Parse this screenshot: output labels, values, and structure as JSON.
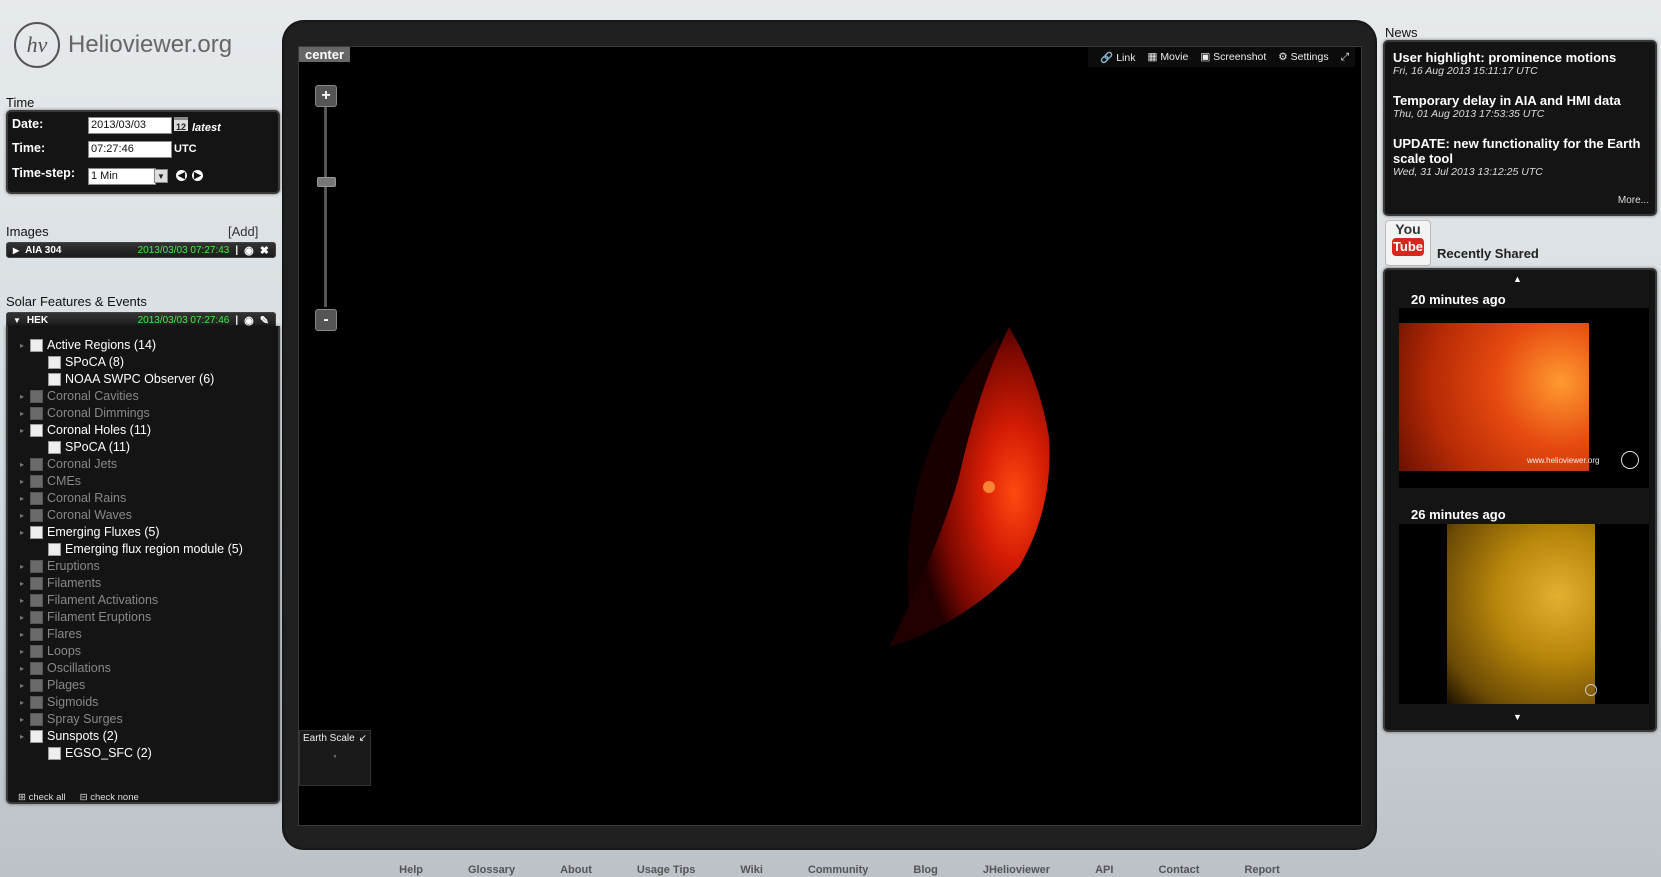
{
  "brand": {
    "logo_mark": "hv",
    "name": "Helioviewer.org"
  },
  "time": {
    "section_title": "Time",
    "date_label": "Date:",
    "date_value": "2013/03/03",
    "calendar_icon": "12",
    "latest_label": "latest",
    "time_label": "Time:",
    "time_value": "07:27:46",
    "utc_label": "UTC",
    "timestep_label": "Time-step:",
    "timestep_value": "1 Min"
  },
  "images": {
    "section_title": "Images",
    "add_label": "[Add]",
    "layer": {
      "name": "AIA 304",
      "timestamp": "2013/03/03 07:27:43",
      "sep": "|"
    }
  },
  "events": {
    "section_title": "Solar Features & Events",
    "header": {
      "name": "HEK",
      "timestamp": "2013/03/03 07:27:46",
      "sep": "|"
    },
    "items": [
      {
        "label": "Active Regions (14)",
        "level": 0,
        "enabled": true
      },
      {
        "label": "SPoCA (8)",
        "level": 1,
        "enabled": true
      },
      {
        "label": "NOAA SWPC Observer (6)",
        "level": 1,
        "enabled": true
      },
      {
        "label": "Coronal Cavities",
        "level": 0,
        "enabled": false
      },
      {
        "label": "Coronal Dimmings",
        "level": 0,
        "enabled": false
      },
      {
        "label": "Coronal Holes (11)",
        "level": 0,
        "enabled": true
      },
      {
        "label": "SPoCA (11)",
        "level": 1,
        "enabled": true
      },
      {
        "label": "Coronal Jets",
        "level": 0,
        "enabled": false
      },
      {
        "label": "CMEs",
        "level": 0,
        "enabled": false
      },
      {
        "label": "Coronal Rains",
        "level": 0,
        "enabled": false
      },
      {
        "label": "Coronal Waves",
        "level": 0,
        "enabled": false
      },
      {
        "label": "Emerging Fluxes (5)",
        "level": 0,
        "enabled": true
      },
      {
        "label": "Emerging flux region module (5)",
        "level": 1,
        "enabled": true
      },
      {
        "label": "Eruptions",
        "level": 0,
        "enabled": false
      },
      {
        "label": "Filaments",
        "level": 0,
        "enabled": false
      },
      {
        "label": "Filament Activations",
        "level": 0,
        "enabled": false
      },
      {
        "label": "Filament Eruptions",
        "level": 0,
        "enabled": false
      },
      {
        "label": "Flares",
        "level": 0,
        "enabled": false
      },
      {
        "label": "Loops",
        "level": 0,
        "enabled": false
      },
      {
        "label": "Oscillations",
        "level": 0,
        "enabled": false
      },
      {
        "label": "Plages",
        "level": 0,
        "enabled": false
      },
      {
        "label": "Sigmoids",
        "level": 0,
        "enabled": false
      },
      {
        "label": "Spray Surges",
        "level": 0,
        "enabled": false
      },
      {
        "label": "Sunspots (2)",
        "level": 0,
        "enabled": true
      },
      {
        "label": "EGSO_SFC (2)",
        "level": 1,
        "enabled": true
      }
    ],
    "check_all": "check all",
    "check_none": "check none"
  },
  "viewport": {
    "center_label": "center",
    "toolbar": {
      "link": "Link",
      "movie": "Movie",
      "screenshot": "Screenshot",
      "settings": "Settings"
    },
    "zoom_in": "+",
    "zoom_out": "-",
    "earth_scale_label": "Earth Scale",
    "sun_color": "#c01500"
  },
  "news": {
    "section_title": "News",
    "items": [
      {
        "title": "User highlight: prominence motions",
        "date": "Fri, 16 Aug 2013 15:11:17 UTC"
      },
      {
        "title": "Temporary delay in AIA and HMI data",
        "date": "Thu, 01 Aug 2013 17:53:35 UTC"
      },
      {
        "title": "UPDATE: new functionality for the Earth scale tool",
        "date": "Wed, 31 Jul 2013 13:12:25 UTC"
      }
    ],
    "more_label": "More..."
  },
  "shared": {
    "youtube_you": "You",
    "youtube_tube": "Tube",
    "title": "Recently Shared",
    "items": [
      {
        "ago": "20 minutes ago",
        "watermark": "www.helioviewer.org",
        "color": "#e04a10"
      },
      {
        "ago": "26 minutes ago",
        "watermark": "",
        "color": "#b8860b"
      }
    ]
  },
  "footer": [
    "Help",
    "Glossary",
    "About",
    "Usage Tips",
    "Wiki",
    "Community",
    "Blog",
    "JHelioviewer",
    "API",
    "Contact",
    "Report"
  ]
}
